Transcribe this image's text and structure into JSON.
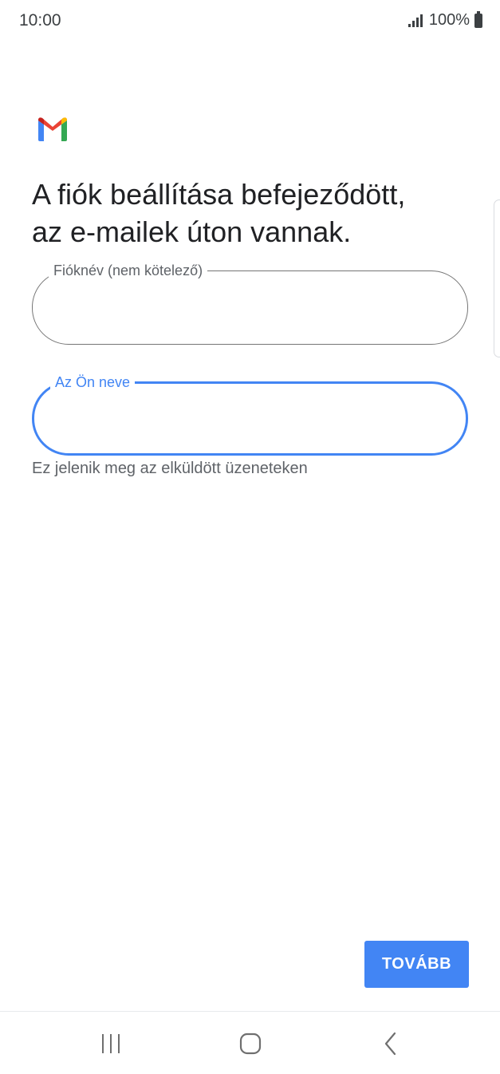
{
  "status_bar": {
    "time": "10:00",
    "battery": "100%",
    "icons": [
      "signal-icon",
      "battery-icon"
    ]
  },
  "app": {
    "logo": "gmail-logo-icon",
    "colors": {
      "accent": "#4285f4",
      "logo_red": "#ea4335",
      "logo_yellow": "#fbbc04",
      "logo_green": "#34a853",
      "logo_blue": "#4285f4"
    }
  },
  "main": {
    "heading_line1": "A fiók beállítása befejeződött,",
    "heading_line2": "az e-mailek úton vannak.",
    "account_name_field": {
      "label": "Fióknév (nem kötelező)",
      "value": "",
      "placeholder": ""
    },
    "your_name_field": {
      "label": "Az Ön neve",
      "value": "",
      "placeholder": "",
      "focused": true
    },
    "helper_text": "Ez jelenik meg az elküldött üzeneteken"
  },
  "footer": {
    "next_label": "TOVÁBB"
  },
  "nav_bar": {
    "icons": [
      "recents-icon",
      "home-icon",
      "back-icon"
    ]
  }
}
